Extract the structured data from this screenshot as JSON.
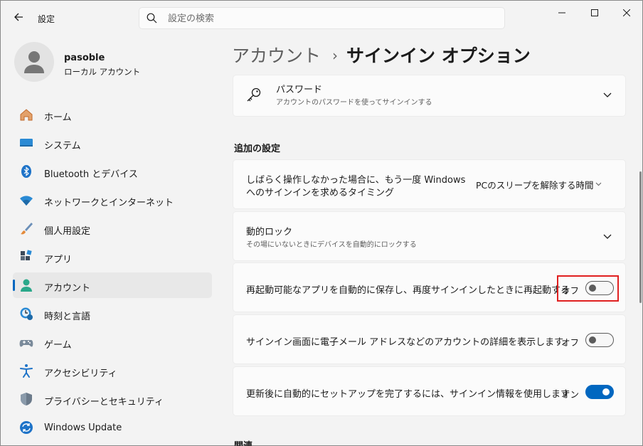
{
  "window": {
    "title": "設定"
  },
  "search": {
    "placeholder": "設定の検索"
  },
  "profile": {
    "name": "pasoble",
    "account_type": "ローカル アカウント"
  },
  "sidebar": {
    "items": [
      {
        "label": "ホーム",
        "icon": "home-icon"
      },
      {
        "label": "システム",
        "icon": "system-icon"
      },
      {
        "label": "Bluetooth とデバイス",
        "icon": "bluetooth-icon"
      },
      {
        "label": "ネットワークとインターネット",
        "icon": "wifi-icon"
      },
      {
        "label": "個人用設定",
        "icon": "brush-icon"
      },
      {
        "label": "アプリ",
        "icon": "apps-icon"
      },
      {
        "label": "アカウント",
        "icon": "account-icon",
        "selected": true
      },
      {
        "label": "時刻と言語",
        "icon": "time-language-icon"
      },
      {
        "label": "ゲーム",
        "icon": "gamepad-icon"
      },
      {
        "label": "アクセシビリティ",
        "icon": "accessibility-icon"
      },
      {
        "label": "プライバシーとセキュリティ",
        "icon": "shield-icon"
      },
      {
        "label": "Windows Update",
        "icon": "windows-update-icon"
      }
    ]
  },
  "breadcrumb": {
    "parent": "アカウント",
    "separator": "›",
    "current": "サインイン オプション"
  },
  "password_card": {
    "title": "パスワード",
    "subtitle": "アカウントのパスワードを使ってサインインする"
  },
  "additional_settings": {
    "heading": "追加の設定",
    "sleep_signin": {
      "line1": "しばらく操作しなかった場合に、もう一度 Windows",
      "line2": "へのサインインを求めるタイミング",
      "selected": "PCのスリープを解除する時間"
    },
    "dynamic_lock": {
      "title": "動的ロック",
      "subtitle": "その場にいないときにデバイスを自動的にロックする"
    },
    "restart_apps": {
      "label": "再起動可能なアプリを自動的に保存し、再度サインインしたときに再起動する",
      "state": "オフ",
      "on": false
    },
    "account_details": {
      "label": "サインイン画面に電子メール アドレスなどのアカウントの詳細を表示します。",
      "state": "オフ",
      "on": false
    },
    "finish_setup": {
      "label": "更新後に自動的にセットアップを完了するには、サインイン情報を使用します",
      "state": "オン",
      "on": true
    }
  },
  "related": {
    "heading": "関連"
  },
  "colors": {
    "accent": "#0067c0",
    "highlight": "#e02020"
  }
}
